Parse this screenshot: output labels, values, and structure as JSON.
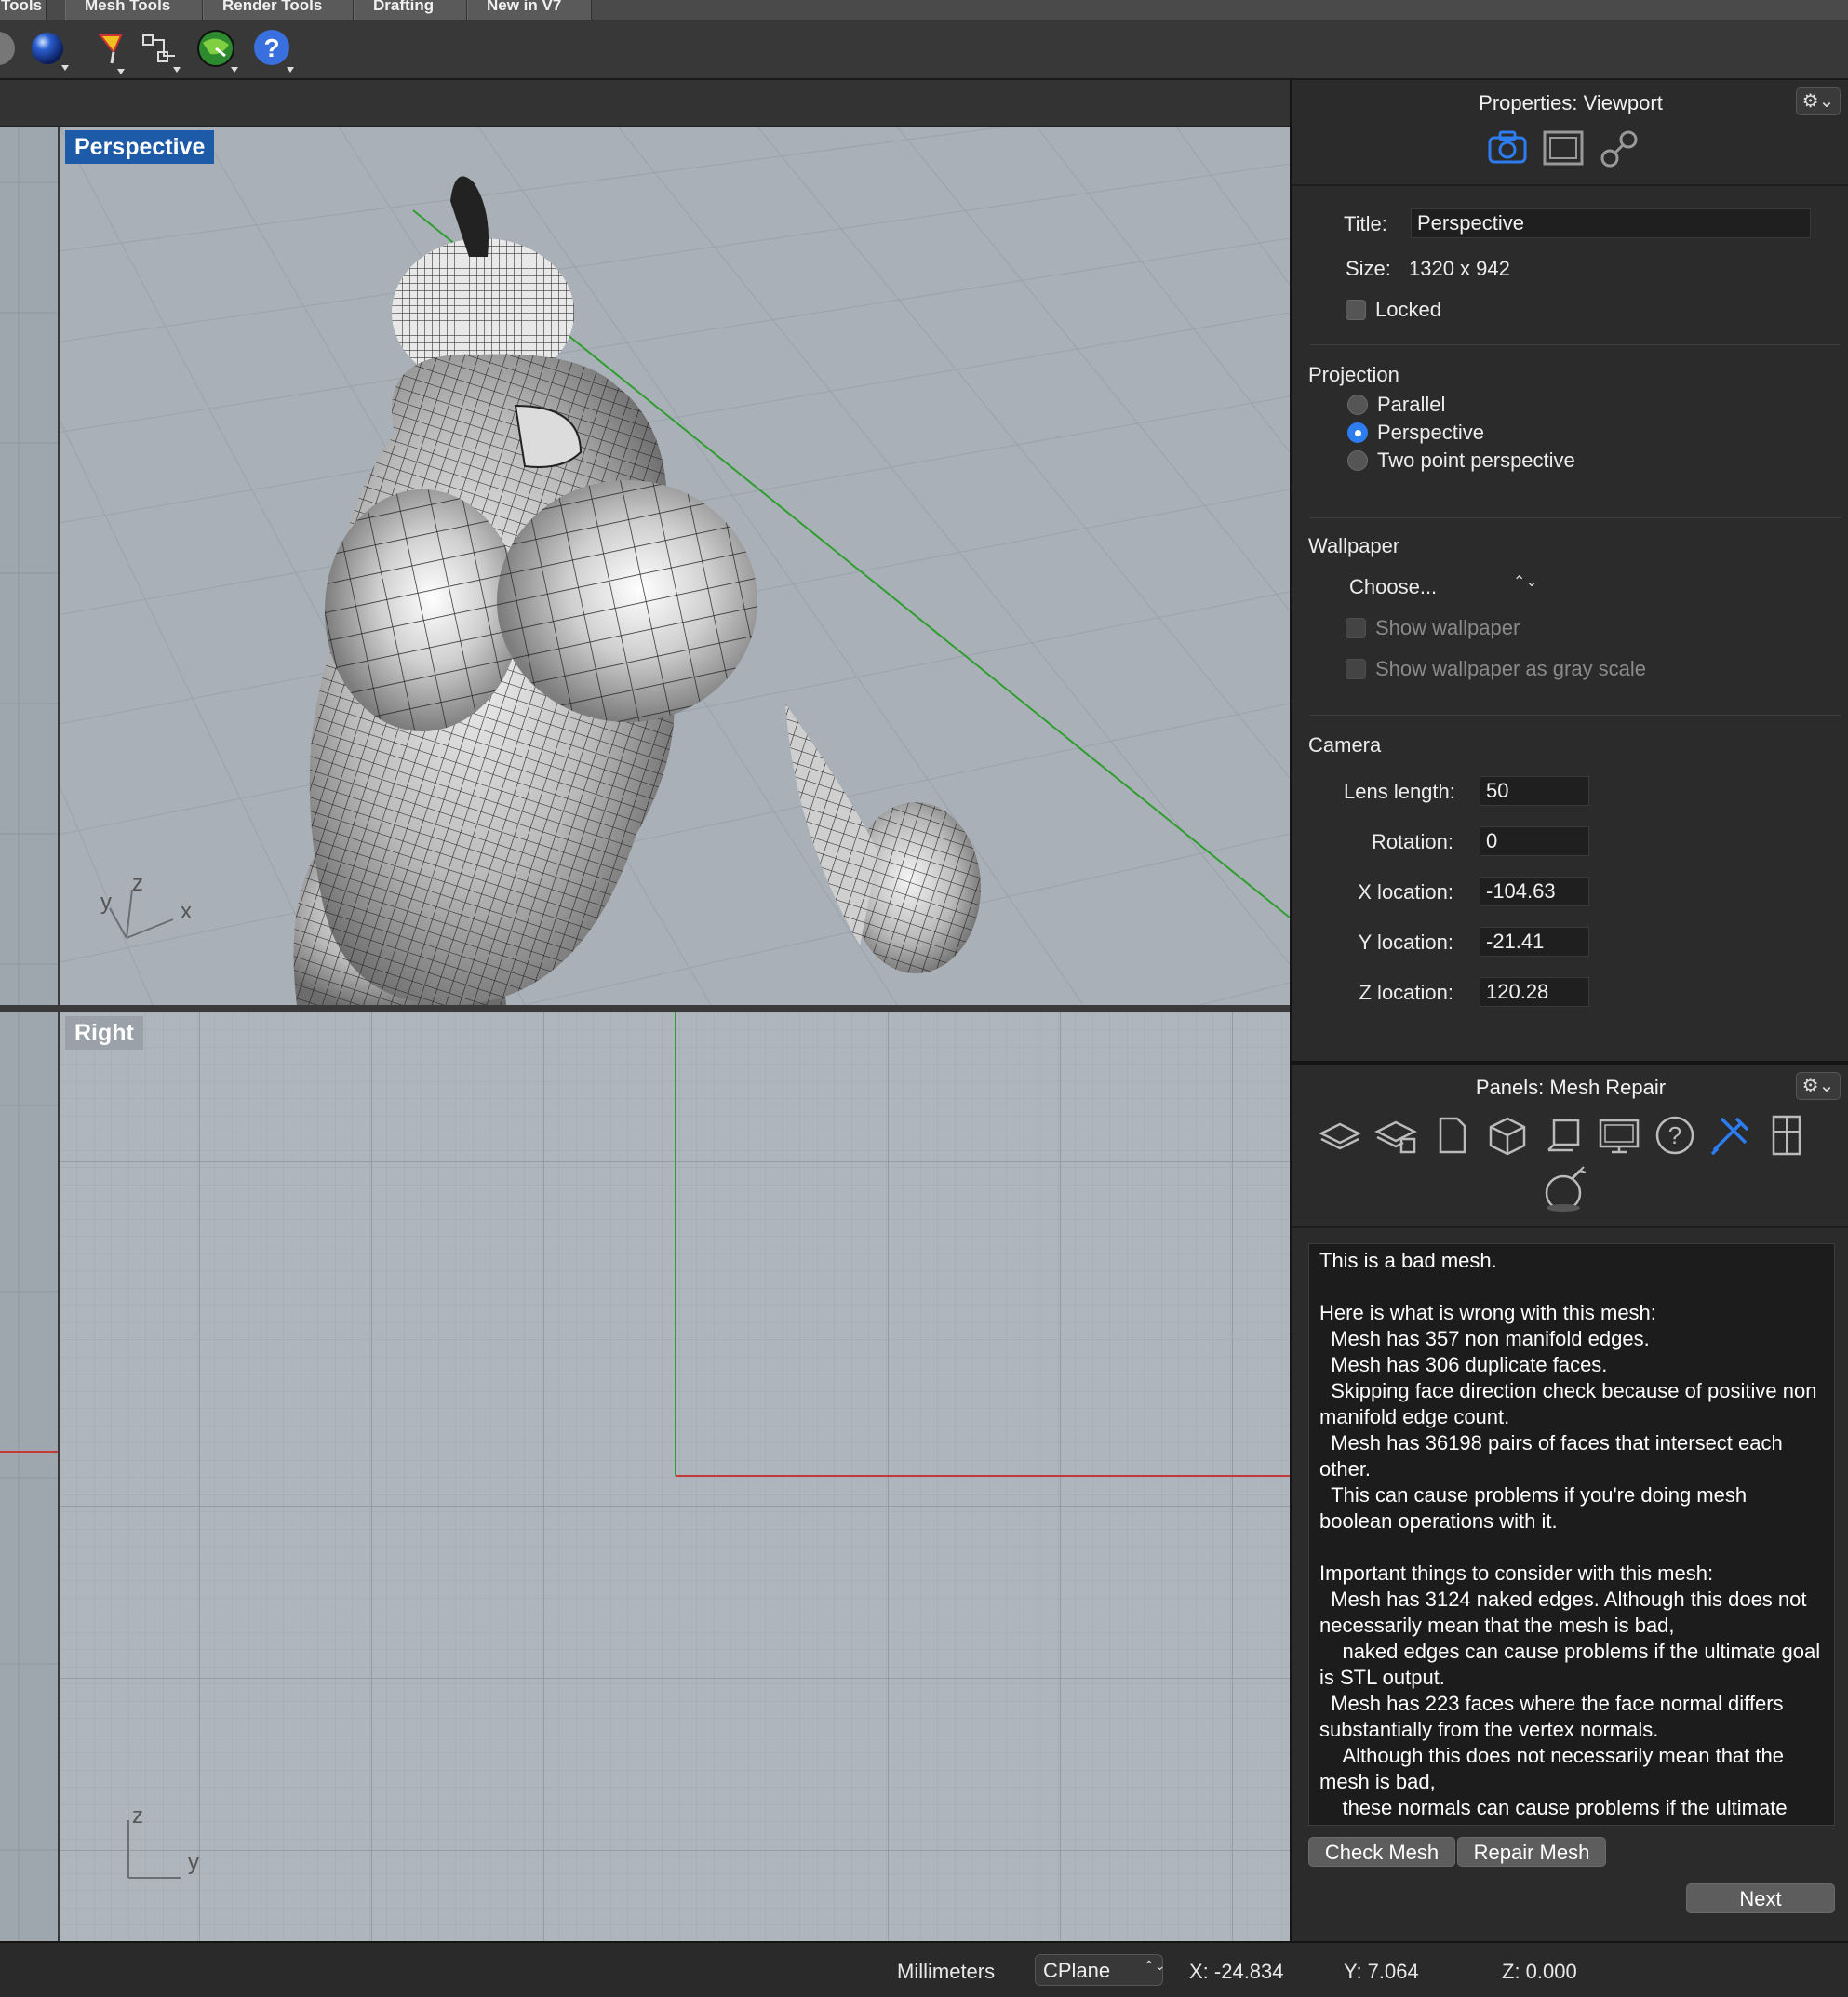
{
  "tabs": [
    "Tools",
    "Mesh Tools",
    "Render Tools",
    "Drafting",
    "New in V7"
  ],
  "toolbar_icons": [
    "sphere-render-icon",
    "material-ball-icon",
    "selection-filter-icon",
    "grid-snap-icon",
    "globe-green-icon",
    "help-icon"
  ],
  "viewports": {
    "top": {
      "label": "Perspective",
      "axes": {
        "x": "x",
        "y": "y",
        "z": "z"
      }
    },
    "bottom": {
      "label": "Right",
      "axes": {
        "y": "y",
        "z": "z"
      }
    }
  },
  "properties": {
    "header": "Properties: Viewport",
    "gear": "⚙⌄",
    "title_label": "Title:",
    "title_value": "Perspective",
    "size_label": "Size:",
    "size_value": "1320 x 942",
    "locked_label": "Locked",
    "projection_heading": "Projection",
    "projection_options": [
      "Parallel",
      "Perspective",
      "Two point perspective"
    ],
    "projection_selected": "Perspective",
    "wallpaper_heading": "Wallpaper",
    "wallpaper_choose": "Choose...",
    "wallpaper_chooser_arrows": "⌃⌄",
    "show_wallpaper": "Show wallpaper",
    "show_wallpaper_gray": "Show wallpaper as gray scale",
    "camera_heading": "Camera",
    "lens_label": "Lens length:",
    "lens_value": "50",
    "rotation_label": "Rotation:",
    "rotation_value": "0",
    "xloc_label": "X location:",
    "xloc_value": "-104.63",
    "yloc_label": "Y location:",
    "yloc_value": "-21.41",
    "zloc_label": "Z location:",
    "zloc_value": "120.28"
  },
  "panels": {
    "header": "Panels: Mesh Repair",
    "gear": "⚙⌄",
    "icons": [
      "layers-icon",
      "layer-states-icon",
      "document-icon",
      "object-box-icon",
      "named-cplane-icon",
      "display-monitor-icon",
      "help-circle-icon",
      "mesh-repair-tools-icon",
      "layout-icon",
      "plugin-bomb-icon"
    ],
    "report_lines": [
      "This is a bad mesh.",
      "",
      "Here is what is wrong with this mesh:",
      "  Mesh has 357 non manifold edges.",
      "  Mesh has 306 duplicate faces.",
      "  Skipping face direction check because of positive non manifold edge count.",
      "  Mesh has 36198 pairs of faces that intersect each other.",
      "  This can cause problems if you're doing mesh boolean operations with it.",
      "",
      "Important things to consider with this mesh:",
      "  Mesh has 3124 naked edges. Although this does not necessarily mean that the mesh is bad,",
      "    naked edges can cause problems if the ultimate goal is STL output.",
      "  Mesh has 223 faces where the face normal differs substantially from the vertex normals.",
      "    Although this does not necessarily mean that the mesh is bad,",
      "    these normals can cause problems if the ultimate goal is for rendering or simulations."
    ],
    "check_button": "Check Mesh",
    "repair_button": "Repair Mesh",
    "next_button": "Next"
  },
  "status": {
    "units": "Millimeters",
    "cplane": "CPlane",
    "cplane_arrows": "⌃⌄",
    "x": "X: -24.834",
    "y": "Y: 7.064",
    "z": "Z: 0.000"
  },
  "colors": {
    "accent_blue": "#2d7cf0",
    "viewport_label_active": "#1d5aa8",
    "viewport_bg": "#a9b0b8",
    "axis_green": "#2f9e2f",
    "axis_red": "#c33a3a"
  }
}
